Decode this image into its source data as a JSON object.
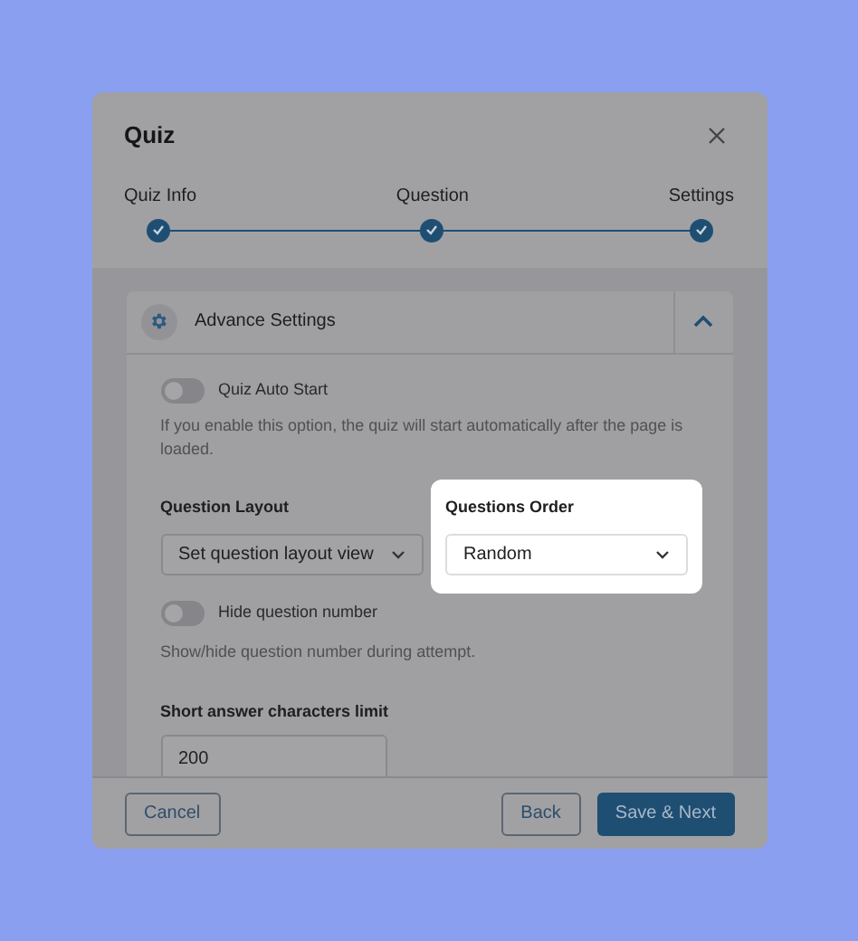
{
  "dialog": {
    "title": "Quiz"
  },
  "steps": [
    {
      "label": "Quiz Info",
      "completed": true
    },
    {
      "label": "Question",
      "completed": true
    },
    {
      "label": "Settings",
      "completed": true
    }
  ],
  "section": {
    "title": "Advance Settings",
    "expanded": true
  },
  "auto_start": {
    "label": "Quiz Auto Start",
    "on": false,
    "help": "If you enable this option, the quiz will start automatically after the page is loaded."
  },
  "question_layout": {
    "label": "Question Layout",
    "value": "Set question layout view"
  },
  "questions_order": {
    "label": "Questions Order",
    "value": "Random",
    "highlighted": true
  },
  "hide_number": {
    "label": "Hide question number",
    "on": false,
    "help": "Show/hide question number during attempt."
  },
  "short_answer_limit": {
    "label": "Short answer characters limit",
    "value": "200"
  },
  "buttons": {
    "cancel": "Cancel",
    "back": "Back",
    "next": "Save & Next"
  }
}
